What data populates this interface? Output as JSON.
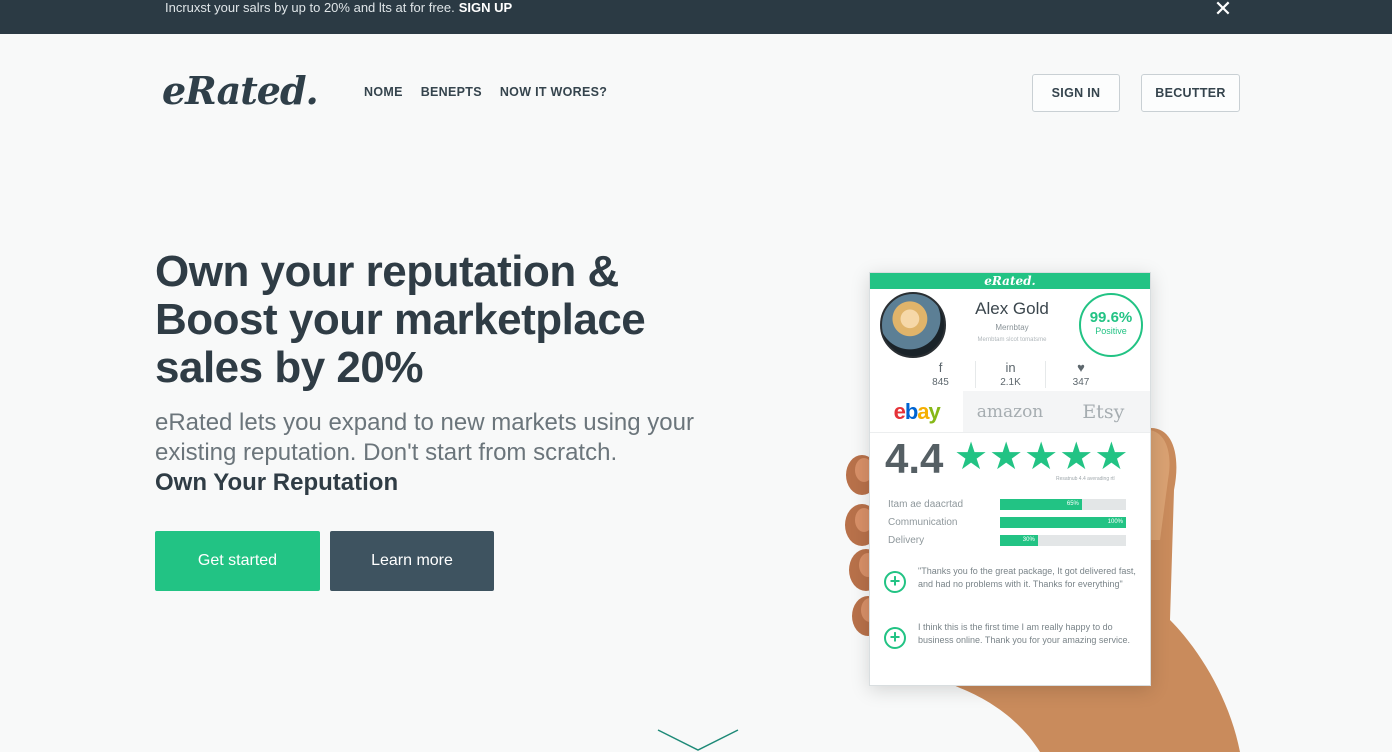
{
  "banner": {
    "text": "Incruxst your salrs by up to 20% and lts at for free.",
    "cta": "SIGN UP",
    "close_glyph": "✕"
  },
  "brand": {
    "logo": "eRated."
  },
  "nav": {
    "items": [
      {
        "label": "NOME"
      },
      {
        "label": "BENEPTS"
      },
      {
        "label": "NOW IT WORES?"
      }
    ],
    "sign_in": "SIGN IN",
    "register": "BECUTTER"
  },
  "hero": {
    "title_line1": "Own your reputation &",
    "title_line2": "Boost your marketplace",
    "title_line3": "sales by 20%",
    "subtitle_line1": "eRated lets you expand to new markets using your",
    "subtitle_line2": "existing reputation. Don't start from scratch.",
    "tagline": "Own Your Reputation",
    "primary_button": "Get started",
    "secondary_button": "Learn more"
  },
  "card": {
    "header": "eRated.",
    "name": "Alex Gold",
    "subtitle": "Mernbtay",
    "since": "Mernbtam slcot tomatsme",
    "score": "99.6%",
    "score_label": "Positive",
    "socials": [
      {
        "icon": "f",
        "count": "845"
      },
      {
        "icon": "in",
        "count": "2.1K"
      },
      {
        "icon": "♥",
        "count": "347"
      }
    ],
    "marketplaces": [
      {
        "name": "ebay",
        "active": true
      },
      {
        "name": "amazon",
        "active": false
      },
      {
        "name": "Etsy",
        "active": false
      }
    ],
    "rating": "4.4",
    "rating_caption": "Resatnub 4.4 averading rtl",
    "metrics": [
      {
        "label": "Itam ae daacrtad",
        "value": 0.65,
        "text": "65%"
      },
      {
        "label": "Communication",
        "value": 1.0,
        "text": "100%"
      },
      {
        "label": "Delivery",
        "value": 0.3,
        "text": "30%"
      }
    ],
    "reviews": [
      {
        "text": "\"Thanks you fo the great package, It got delivered fast, and had no problems with it. Thanks for everything\""
      },
      {
        "text": "I think this is the first time I am really happy to do business online. Thank you for your amazing service."
      }
    ],
    "colors": {
      "accent": "#22c384",
      "dark": "#2b3a44"
    }
  }
}
